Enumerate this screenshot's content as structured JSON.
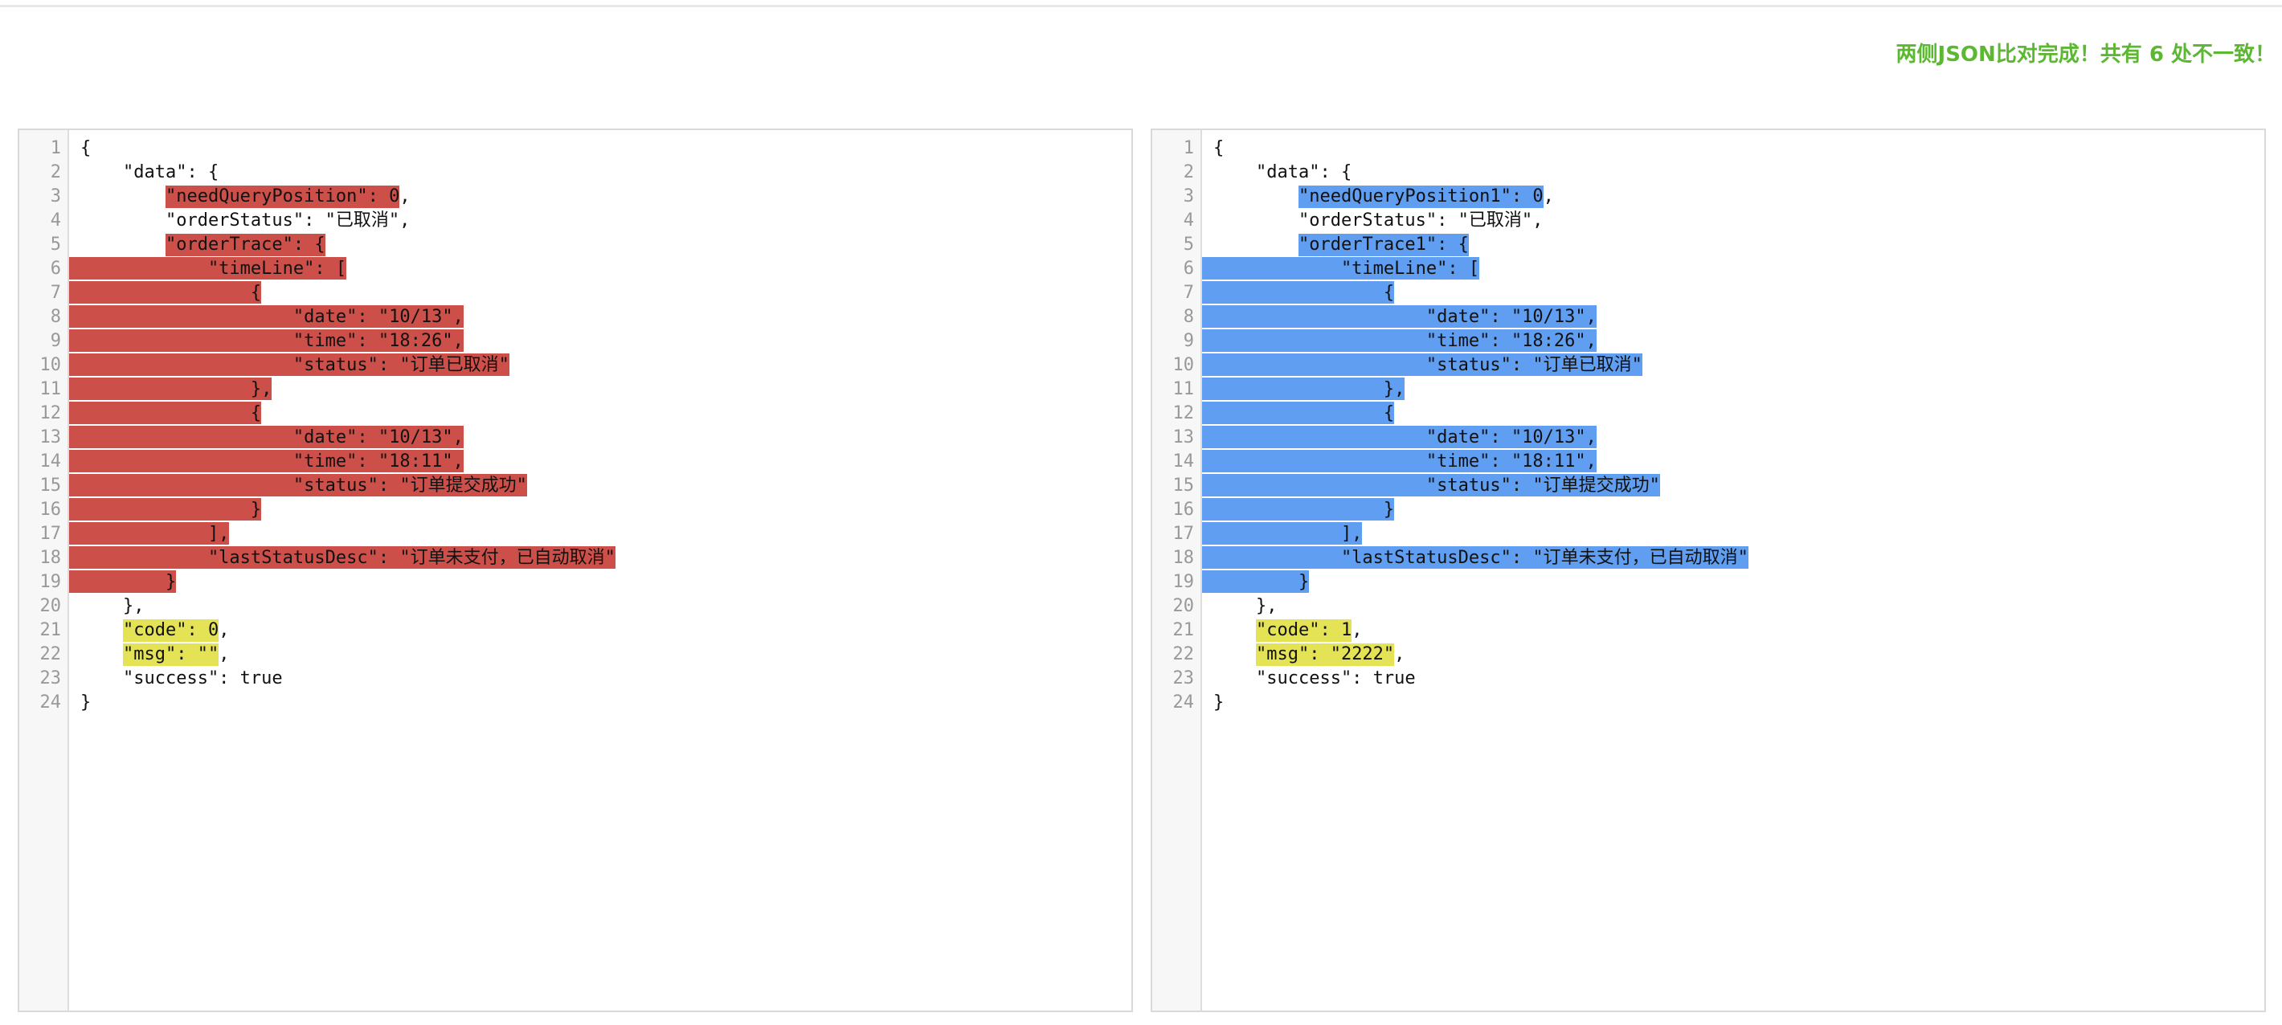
{
  "status_message": "两侧JSON比对完成！共有 6 处不一致！",
  "colors": {
    "status": "#5cb832",
    "left_diff": "#cc5049",
    "right_diff": "#5f9ef0",
    "value_diff": "#e4e355"
  },
  "left": {
    "lines": [
      "{",
      "    \"data\": {",
      "        \"needQueryPosition\": 0,",
      "        \"orderStatus\": \"已取消\",",
      "        \"orderTrace\": {",
      "            \"timeLine\": [",
      "                {",
      "                    \"date\": \"10/13\",",
      "                    \"time\": \"18:26\",",
      "                    \"status\": \"订单已取消\"",
      "                },",
      "                {",
      "                    \"date\": \"10/13\",",
      "                    \"time\": \"18:11\",",
      "                    \"status\": \"订单提交成功\"",
      "                }",
      "            ],",
      "            \"lastStatusDesc\": \"订单未支付，已自动取消\"",
      "        }",
      "    },",
      "    \"code\": 0,",
      "    \"msg\": \"\",",
      "    \"success\": true",
      "}"
    ],
    "segments": [
      [
        {
          "t": "{"
        }
      ],
      [
        {
          "t": "    \"data\": {"
        }
      ],
      [
        {
          "t": "        "
        },
        {
          "t": "\"needQueryPosition\": 0",
          "h": "red"
        },
        {
          "t": ","
        }
      ],
      [
        {
          "t": "        \"orderStatus\": \"已取消\","
        }
      ],
      [
        {
          "t": "        "
        },
        {
          "t": "\"orderTrace\": {",
          "h": "red"
        }
      ],
      [
        {
          "t": "            \"timeLine\": [",
          "h": "red"
        }
      ],
      [
        {
          "t": "                {",
          "h": "red"
        }
      ],
      [
        {
          "t": "                    \"date\": \"10/13\",",
          "h": "red"
        }
      ],
      [
        {
          "t": "                    \"time\": \"18:26\",",
          "h": "red"
        }
      ],
      [
        {
          "t": "                    \"status\": \"订单已取消\"",
          "h": "red"
        }
      ],
      [
        {
          "t": "                },",
          "h": "red"
        }
      ],
      [
        {
          "t": "                {",
          "h": "red"
        }
      ],
      [
        {
          "t": "                    \"date\": \"10/13\",",
          "h": "red"
        }
      ],
      [
        {
          "t": "                    \"time\": \"18:11\",",
          "h": "red"
        }
      ],
      [
        {
          "t": "                    \"status\": \"订单提交成功\"",
          "h": "red"
        }
      ],
      [
        {
          "t": "                }",
          "h": "red"
        }
      ],
      [
        {
          "t": "            ],",
          "h": "red"
        }
      ],
      [
        {
          "t": "            \"lastStatusDesc\": \"订单未支付，已自动取消\"",
          "h": "red"
        }
      ],
      [
        {
          "t": "        }",
          "h": "red"
        }
      ],
      [
        {
          "t": "    },"
        }
      ],
      [
        {
          "t": "    "
        },
        {
          "t": "\"code\": 0",
          "h": "yellow"
        },
        {
          "t": ","
        }
      ],
      [
        {
          "t": "    "
        },
        {
          "t": "\"msg\": \"\"",
          "h": "yellow"
        },
        {
          "t": ","
        }
      ],
      [
        {
          "t": "    \"success\": true"
        }
      ],
      [
        {
          "t": "}"
        }
      ]
    ]
  },
  "right": {
    "lines": [
      "{",
      "    \"data\": {",
      "        \"needQueryPosition1\": 0,",
      "        \"orderStatus\": \"已取消\",",
      "        \"orderTrace1\": {",
      "            \"timeLine\": [",
      "                {",
      "                    \"date\": \"10/13\",",
      "                    \"time\": \"18:26\",",
      "                    \"status\": \"订单已取消\"",
      "                },",
      "                {",
      "                    \"date\": \"10/13\",",
      "                    \"time\": \"18:11\",",
      "                    \"status\": \"订单提交成功\"",
      "                }",
      "            ],",
      "            \"lastStatusDesc\": \"订单未支付，已自动取消\"",
      "        }",
      "    },",
      "    \"code\": 1,",
      "    \"msg\": \"2222\",",
      "    \"success\": true",
      "}"
    ],
    "segments": [
      [
        {
          "t": "{"
        }
      ],
      [
        {
          "t": "    \"data\": {"
        }
      ],
      [
        {
          "t": "        "
        },
        {
          "t": "\"needQueryPosition1\": 0",
          "h": "blue"
        },
        {
          "t": ","
        }
      ],
      [
        {
          "t": "        \"orderStatus\": \"已取消\","
        }
      ],
      [
        {
          "t": "        "
        },
        {
          "t": "\"orderTrace1\": {",
          "h": "blue"
        }
      ],
      [
        {
          "t": "            \"timeLine\": [",
          "h": "blue"
        }
      ],
      [
        {
          "t": "                {",
          "h": "blue"
        }
      ],
      [
        {
          "t": "                    \"date\": \"10/13\",",
          "h": "blue"
        }
      ],
      [
        {
          "t": "                    \"time\": \"18:26\",",
          "h": "blue"
        }
      ],
      [
        {
          "t": "                    \"status\": \"订单已取消\"",
          "h": "blue"
        }
      ],
      [
        {
          "t": "                },",
          "h": "blue"
        }
      ],
      [
        {
          "t": "                {",
          "h": "blue"
        }
      ],
      [
        {
          "t": "                    \"date\": \"10/13\",",
          "h": "blue"
        }
      ],
      [
        {
          "t": "                    \"time\": \"18:11\",",
          "h": "blue"
        }
      ],
      [
        {
          "t": "                    \"status\": \"订单提交成功\"",
          "h": "blue"
        }
      ],
      [
        {
          "t": "                }",
          "h": "blue"
        }
      ],
      [
        {
          "t": "            ],",
          "h": "blue"
        }
      ],
      [
        {
          "t": "            \"lastStatusDesc\": \"订单未支付，已自动取消\"",
          "h": "blue"
        }
      ],
      [
        {
          "t": "        }",
          "h": "blue"
        }
      ],
      [
        {
          "t": "    },"
        }
      ],
      [
        {
          "t": "    "
        },
        {
          "t": "\"code\": 1",
          "h": "yellow"
        },
        {
          "t": ","
        }
      ],
      [
        {
          "t": "    "
        },
        {
          "t": "\"msg\": \"2222\"",
          "h": "yellow"
        },
        {
          "t": ","
        }
      ],
      [
        {
          "t": "    \"success\": true"
        }
      ],
      [
        {
          "t": "}"
        }
      ]
    ]
  }
}
